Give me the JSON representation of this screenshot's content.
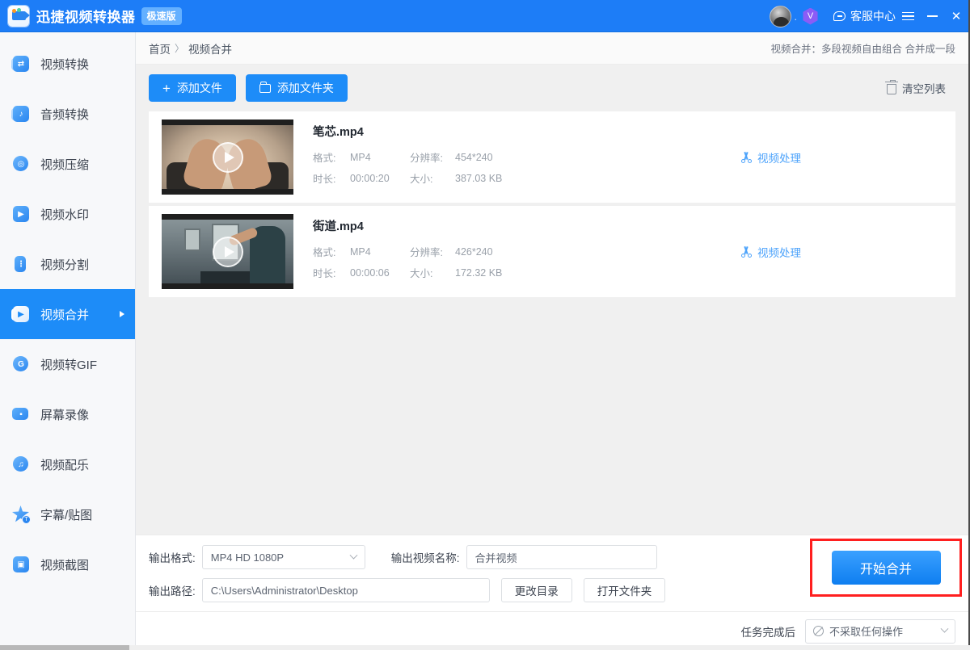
{
  "titlebar": {
    "app_name": "迅捷视频转换器",
    "edition_tag": "极速版",
    "avatar_dot": ".",
    "vip_glyph": "V",
    "service_center": "客服中心",
    "menu_icon": "hamburger-icon",
    "minimize_icon": "minimize-icon",
    "close_label": "✕"
  },
  "sidebar": {
    "items": [
      {
        "label": "视频转换",
        "icon": "video-convert-icon",
        "glyph": "↗",
        "active": false
      },
      {
        "label": "音频转换",
        "icon": "audio-convert-icon",
        "glyph": "♪",
        "active": false
      },
      {
        "label": "视频压缩",
        "icon": "video-compress-icon",
        "glyph": "◎",
        "active": false
      },
      {
        "label": "视频水印",
        "icon": "video-watermark-icon",
        "glyph": "▶",
        "active": false
      },
      {
        "label": "视频分割",
        "icon": "video-split-icon",
        "glyph": "⋮",
        "active": false
      },
      {
        "label": "视频合并",
        "icon": "video-merge-icon",
        "glyph": "▶",
        "active": true
      },
      {
        "label": "视频转GIF",
        "icon": "video-to-gif-icon",
        "glyph": "G",
        "active": false
      },
      {
        "label": "屏幕录像",
        "icon": "screen-record-icon",
        "glyph": "▪",
        "active": false
      },
      {
        "label": "视频配乐",
        "icon": "video-music-icon",
        "glyph": "♫",
        "active": false
      },
      {
        "label": "字幕/贴图",
        "icon": "subtitle-sticker-icon",
        "glyph": "★",
        "active": false
      },
      {
        "label": "视频截图",
        "icon": "video-snapshot-icon",
        "glyph": "▣",
        "active": false
      }
    ]
  },
  "breadcrumb": {
    "home": "首页",
    "separator": "〉",
    "current": "视频合并",
    "hint": "视频合并：多段视频自由组合 合并成一段"
  },
  "toolbar": {
    "add_file": "添加文件",
    "add_file_icon": "plus-icon",
    "add_folder": "添加文件夹",
    "add_folder_icon": "folder-icon",
    "clear_list": "清空列表",
    "clear_list_icon": "trash-icon"
  },
  "file_list": {
    "labels": {
      "format": "格式:",
      "resolution": "分辨率:",
      "duration": "时长:",
      "size": "大小:"
    },
    "action_label": "视频处理",
    "action_icon": "scissors-icon",
    "rows": [
      {
        "name": "笔芯.mp4",
        "format": "MP4",
        "resolution": "454*240",
        "duration": "00:00:20",
        "size": "387.03 KB",
        "thumb": "heart-hands-scene"
      },
      {
        "name": "街道.mp4",
        "format": "MP4",
        "resolution": "426*240",
        "duration": "00:00:06",
        "size": "172.32 KB",
        "thumb": "street-indoor-scene"
      }
    ]
  },
  "output": {
    "format_label": "输出格式:",
    "format_value": "MP4  HD 1080P",
    "name_label": "输出视频名称:",
    "name_value": "合并视频",
    "path_label": "输出路径:",
    "path_value": "C:\\Users\\Administrator\\Desktop",
    "change_dir": "更改目录",
    "open_folder": "打开文件夹",
    "start_button": "开始合并"
  },
  "statusbar": {
    "after_task_label": "任务完成后",
    "after_task_value": "不采取任何操作",
    "after_task_icon": "ban-icon"
  }
}
